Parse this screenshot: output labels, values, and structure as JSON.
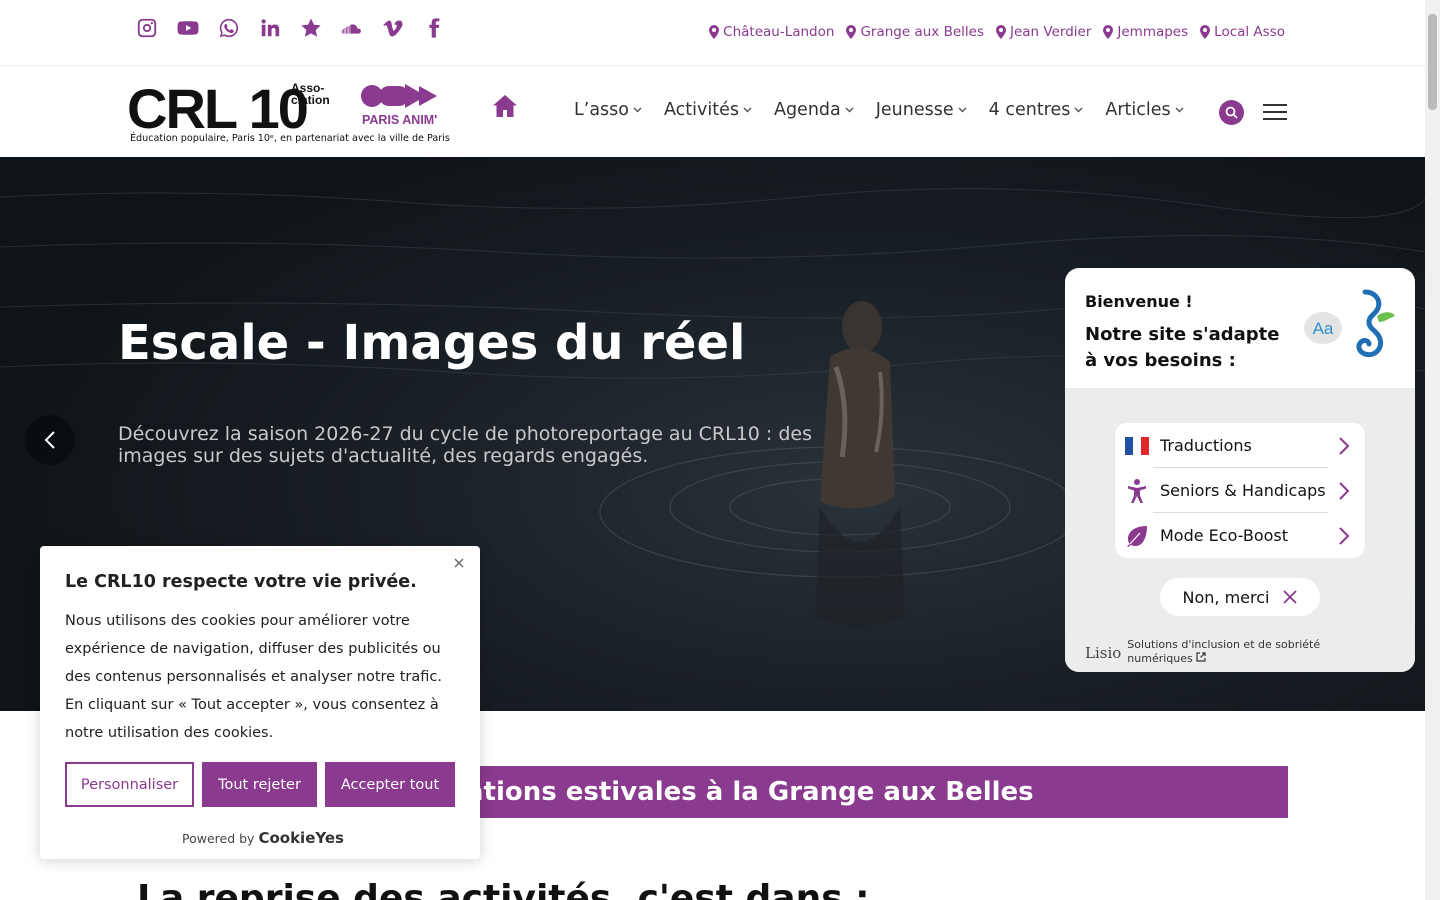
{
  "social": [
    "instagram-icon",
    "youtube-icon",
    "whatsapp-icon",
    "linkedin-icon",
    "star-icon",
    "soundcloud-icon",
    "vimeo-icon",
    "facebook-icon"
  ],
  "locations": [
    "Château-Landon",
    "Grange aux Belles",
    "Jean Verdier",
    "Jemmapes",
    "Local Asso"
  ],
  "logo": {
    "text": "CRL 10",
    "asso": "Asso-",
    "ciation": "ciation",
    "partner": "PARIS ANIM'",
    "tagline": "Éducation populaire, Paris 10ᵉ, en partenariat avec la ville de Paris"
  },
  "nav": [
    "L’asso",
    "Activités",
    "Agenda",
    "Jeunesse",
    "4 centres",
    "Articles"
  ],
  "hero": {
    "title": "Escale - Images du réel",
    "text": "Découvrez la saison 2026-27 du cycle de photoreportage au CRL10 : des images sur des sujets d'actualité, des regards engagés."
  },
  "lisio": {
    "hello": "Bienvenue !",
    "adapt": "Notre site s'adapte à vos besoins :",
    "badge": "Aa",
    "items": [
      "Traductions",
      "Seniors & Handicaps",
      "Mode Eco-Boost"
    ],
    "no_thanks": "Non, merci",
    "brand": "Lisio",
    "footer": "Solutions d'inclusion et de sobriété numériques"
  },
  "banner": "Animations estivales à la Grange aux Belles",
  "heading": "La reprise des activités, c'est dans :",
  "cookie": {
    "title": "Le CRL10 respecte votre vie privée.",
    "text": "Nous utilisons des cookies pour améliorer votre expérience de navigation, diffuser des publicités ou des contenus personnalisés et analyser notre trafic. En cliquant sur « Tout accepter », vous consentez à notre utilisation des cookies.",
    "customize": "Personnaliser",
    "reject": "Tout rejeter",
    "accept": "Accepter tout",
    "powered": "Powered by",
    "powered_brand": "CookieYes"
  },
  "colors": {
    "accent": "#8a3a8f"
  }
}
